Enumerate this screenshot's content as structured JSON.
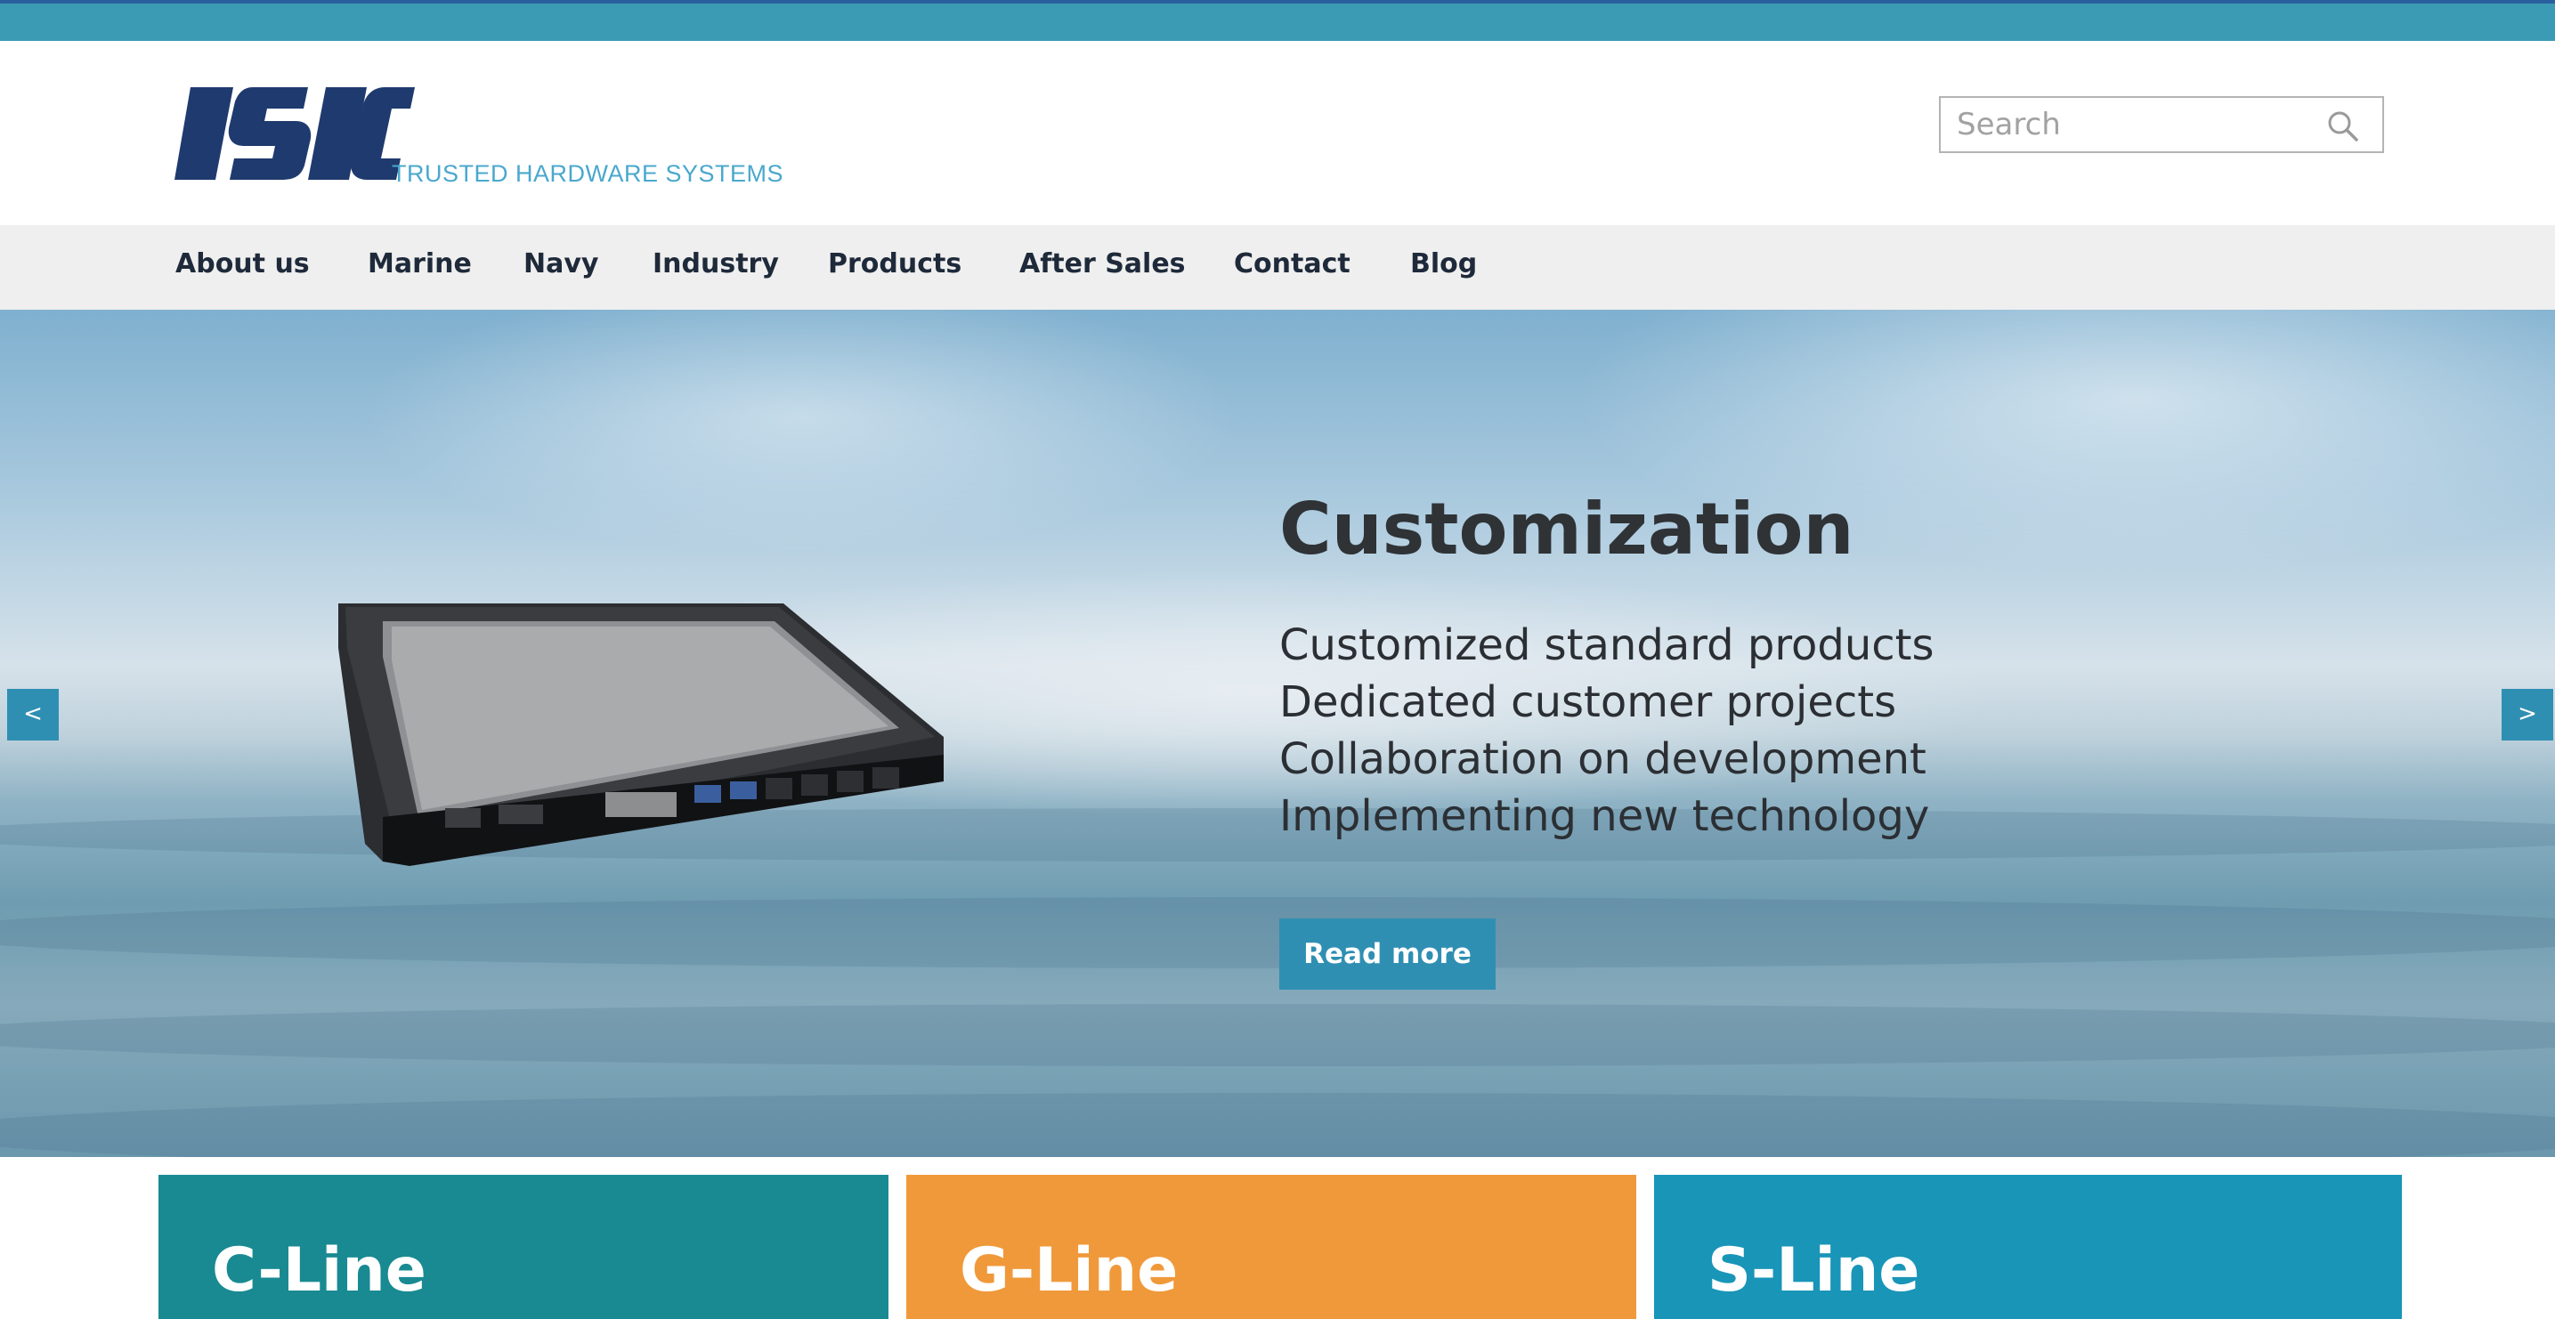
{
  "header": {
    "logo": {
      "mark": "ISIC",
      "tagline": "TRUSTED HARDWARE SYSTEMS",
      "brand_color": "#1f3a6e",
      "accent_color": "#4aa8cd"
    },
    "search": {
      "placeholder": "Search",
      "value": ""
    }
  },
  "nav": {
    "items": [
      {
        "label": "About us"
      },
      {
        "label": "Marine"
      },
      {
        "label": "Navy"
      },
      {
        "label": "Industry"
      },
      {
        "label": "Products"
      },
      {
        "label": "After Sales"
      },
      {
        "label": "Contact"
      },
      {
        "label": "Blog"
      }
    ]
  },
  "hero": {
    "title": "Customization",
    "lines": [
      "Customized standard products",
      "Dedicated customer projects",
      "Collaboration on development",
      "Implementing new technology"
    ],
    "cta_label": "Read more",
    "prev_label": "<",
    "next_label": ">"
  },
  "cards": [
    {
      "title": "C-Line",
      "color": "#198a92"
    },
    {
      "title": "G-Line",
      "color": "#f0993a"
    },
    {
      "title": "S-Line",
      "color": "#1995b8"
    }
  ],
  "colors": {
    "topbar": "#3b9bb4",
    "nav_bg": "#efefef",
    "button": "#2f8fb3"
  }
}
